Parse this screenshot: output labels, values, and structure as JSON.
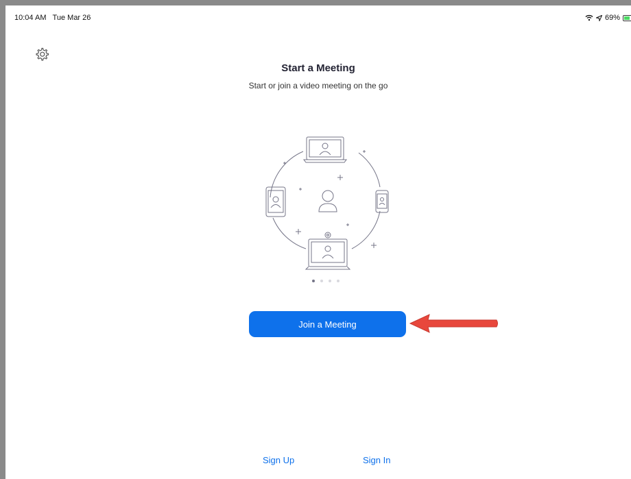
{
  "status_bar": {
    "time": "10:04 AM",
    "date": "Tue Mar 26",
    "battery_text": "69%",
    "battery_level": 0.69,
    "icons": [
      "wifi-icon",
      "location-icon",
      "battery-icon"
    ]
  },
  "toolbar": {
    "settings_icon": "gear-icon"
  },
  "main": {
    "title": "Start a Meeting",
    "subtitle": "Start or join a video meeting on the go",
    "illustration_icon": "connected-devices-illustration",
    "page_indicator": {
      "count": 4,
      "active_index": 0
    },
    "join_button_label": "Join a Meeting"
  },
  "footer": {
    "sign_up_label": "Sign Up",
    "sign_in_label": "Sign In"
  },
  "annotation": {
    "arrow_color": "#e8473c",
    "arrow_icon": "red-arrow-annotation"
  },
  "colors": {
    "accent": "#0e71eb",
    "title_text": "#232333",
    "illustration_stroke": "#747487"
  }
}
